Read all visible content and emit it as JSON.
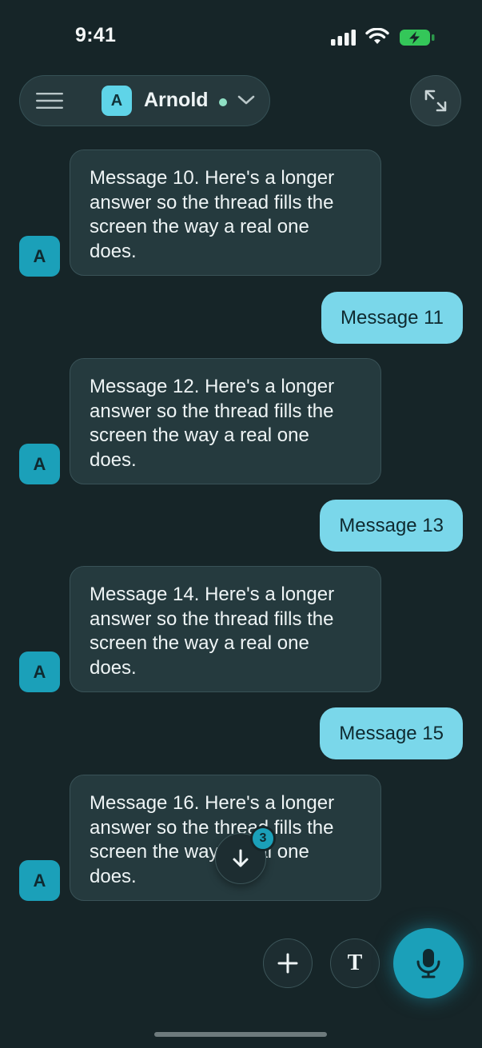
{
  "status_bar": {
    "time": "9:41",
    "icons": [
      "cellular-signal-icon",
      "wifi-icon",
      "battery-charging-icon"
    ],
    "battery_color": "#34c759"
  },
  "header": {
    "menu_icon": "hamburger-menu-icon",
    "agent_initial": "A",
    "agent_name": "Arnold",
    "online_status_color": "#8fe0c4",
    "dropdown_icon": "chevron-down-icon",
    "expand_icon": "expand-arrows-icon"
  },
  "messages": [
    {
      "from": "agent",
      "avatar": "A",
      "text": "Message 10. Here's a longer answer so the thread fills the screen the way a real one does."
    },
    {
      "from": "user",
      "text": "Message 11"
    },
    {
      "from": "agent",
      "avatar": "A",
      "text": "Message 12. Here's a longer answer so the thread fills the screen the way a real one does."
    },
    {
      "from": "user",
      "text": "Message 13"
    },
    {
      "from": "agent",
      "avatar": "A",
      "text": "Message 14. Here's a longer answer so the thread fills the screen the way a real one does."
    },
    {
      "from": "user",
      "text": "Message 15"
    },
    {
      "from": "agent",
      "avatar": "A",
      "text": "Message 16. Here's a longer answer so the thread fills the screen the way a real one does."
    }
  ],
  "scroll_to_bottom": {
    "icon": "arrow-down-icon",
    "unread_count": "3"
  },
  "toolbar": {
    "add_icon": "plus-icon",
    "text_mode_label": "T",
    "mic_icon": "microphone-icon"
  },
  "colors": {
    "background": "#162528",
    "accent": "#1ba0b9",
    "user_bubble": "#7ad7ea",
    "agent_bubble": "#253a3e"
  }
}
